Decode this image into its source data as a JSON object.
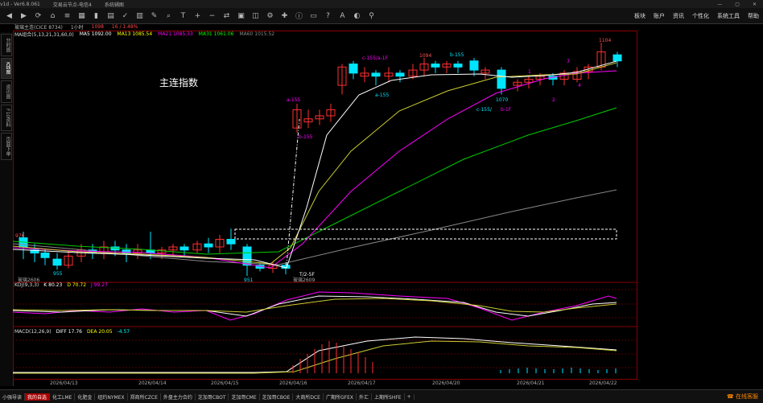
{
  "window": {
    "title_items": [
      "v1d  -  Ver6.8.061",
      "交易云节点-电信4",
      "系统辅图"
    ],
    "controls": [
      "—",
      "▢",
      "✕"
    ]
  },
  "toolbar_icons": [
    "back-icon",
    "forward-icon",
    "refresh-icon",
    "home-icon",
    "list-icon",
    "chart-icon",
    "bar-icon",
    "grid-icon",
    "tick-icon",
    "kline-icon",
    "draw-icon",
    "search-icon",
    "text-icon",
    "zoom-in-icon",
    "zoom-out-icon",
    "compare-icon",
    "layout-icon",
    "split-icon",
    "settings-icon",
    "tools-icon",
    "info-icon",
    "window-icon",
    "help-icon",
    "font-icon",
    "color-icon",
    "pin-icon"
  ],
  "right_menu": [
    "板块",
    "账户",
    "资讯",
    "个性化",
    "系统工具",
    "帮助"
  ],
  "infobar": {
    "symbol": "玻璃主连(CICE 8734)",
    "period": "1小时",
    "price": "1098",
    "change": "16 / 1.48%"
  },
  "sidebar_tabs": [
    "分时图",
    "K线图",
    "资讯图",
    "F10资料",
    "页面下单"
  ],
  "sidebar_active": 1,
  "ma_line": {
    "label": "MA组合(5,13,21,31,60,0)",
    "ma5": "MA5 1092.00",
    "ma13": "MA13 1085.54",
    "ma21": "MA21 1085.33",
    "ma31": "MA31 1061.06",
    "ma60": "MA60 1015.52"
  },
  "colors": {
    "ma5": "#ffffff",
    "ma13": "#ffff00",
    "ma21": "#ff00ff",
    "ma31": "#00ff00",
    "ma60": "#888888",
    "up": "#ff3030",
    "down": "#00e5ff",
    "accent": "#ff8000"
  },
  "watermark": "主连指数",
  "kdj": {
    "label": "KDJ(9,3,3)",
    "k": "K 80.23",
    "d": "D 70.72",
    "j": "J 99.27"
  },
  "macd": {
    "label": "MACD(12,26,9)",
    "diff": "DIFF 17.76",
    "dea": "DEA 20.05",
    "macd": "-4.57"
  },
  "dates": [
    "2026/04/13",
    "2026/04/14",
    "2026/04/15",
    "2026/04/16",
    "2026/04/17",
    "2026/04/20",
    "2026/04/21",
    "2026/04/22"
  ],
  "bottom_tabs": [
    "小强导读",
    "我的自选",
    "化工LME",
    "化肥金",
    "纽约NYMEX",
    "郑商所CZCE",
    "外盘主力合约",
    "芝加哥CBOT",
    "芝加哥CME",
    "芝加哥CBOE",
    "大商所DCE",
    "广期所GFEX",
    "外汇",
    "上期所SHFE",
    "+"
  ],
  "bottom_active": 1,
  "online": "在线客服",
  "chart_data": {
    "type": "candlestick",
    "annotations": [
      "1104",
      "5/c-1F/a-5F",
      "c-155/a-1F",
      "1094",
      "b-155",
      "a-155",
      "1070",
      "c-155/",
      "b-1F",
      "a-155",
      "b-155",
      "976",
      "955",
      "951",
      "T/2-5F",
      "玻璃2606",
      "玻璃2609",
      "1",
      "2",
      "3",
      "4"
    ],
    "price_high": 1104,
    "price_low": 951
  }
}
